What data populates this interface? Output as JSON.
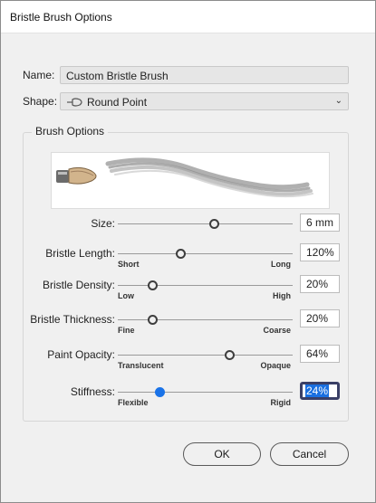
{
  "dialog": {
    "title": "Bristle Brush Options"
  },
  "name": {
    "label": "Name:",
    "value": "Custom Bristle Brush"
  },
  "shape": {
    "label": "Shape:",
    "value": "Round Point",
    "icon": "round-point-brush-icon"
  },
  "brush_options": {
    "title": "Brush Options",
    "sliders": [
      {
        "label": "Size:",
        "min_label": "",
        "max_label": "",
        "value": "6 mm",
        "level": 0.55
      },
      {
        "label": "Bristle Length:",
        "min_label": "Short",
        "max_label": "Long",
        "value": "120%",
        "level": 0.36
      },
      {
        "label": "Bristle Density:",
        "min_label": "Low",
        "max_label": "High",
        "value": "20%",
        "level": 0.2
      },
      {
        "label": "Bristle Thickness:",
        "min_label": "Fine",
        "max_label": "Coarse",
        "value": "20%",
        "level": 0.2
      },
      {
        "label": "Paint Opacity:",
        "min_label": "Translucent",
        "max_label": "Opaque",
        "value": "64%",
        "level": 0.64
      },
      {
        "label": "Stiffness:",
        "min_label": "Flexible",
        "max_label": "Rigid",
        "value": "24%",
        "level": 0.24
      }
    ]
  },
  "buttons": {
    "ok": "OK",
    "cancel": "Cancel"
  },
  "colors": {
    "accent": "#1a73e8",
    "focus_ring": "#3a3f66",
    "selection": "#1a6fe0"
  }
}
